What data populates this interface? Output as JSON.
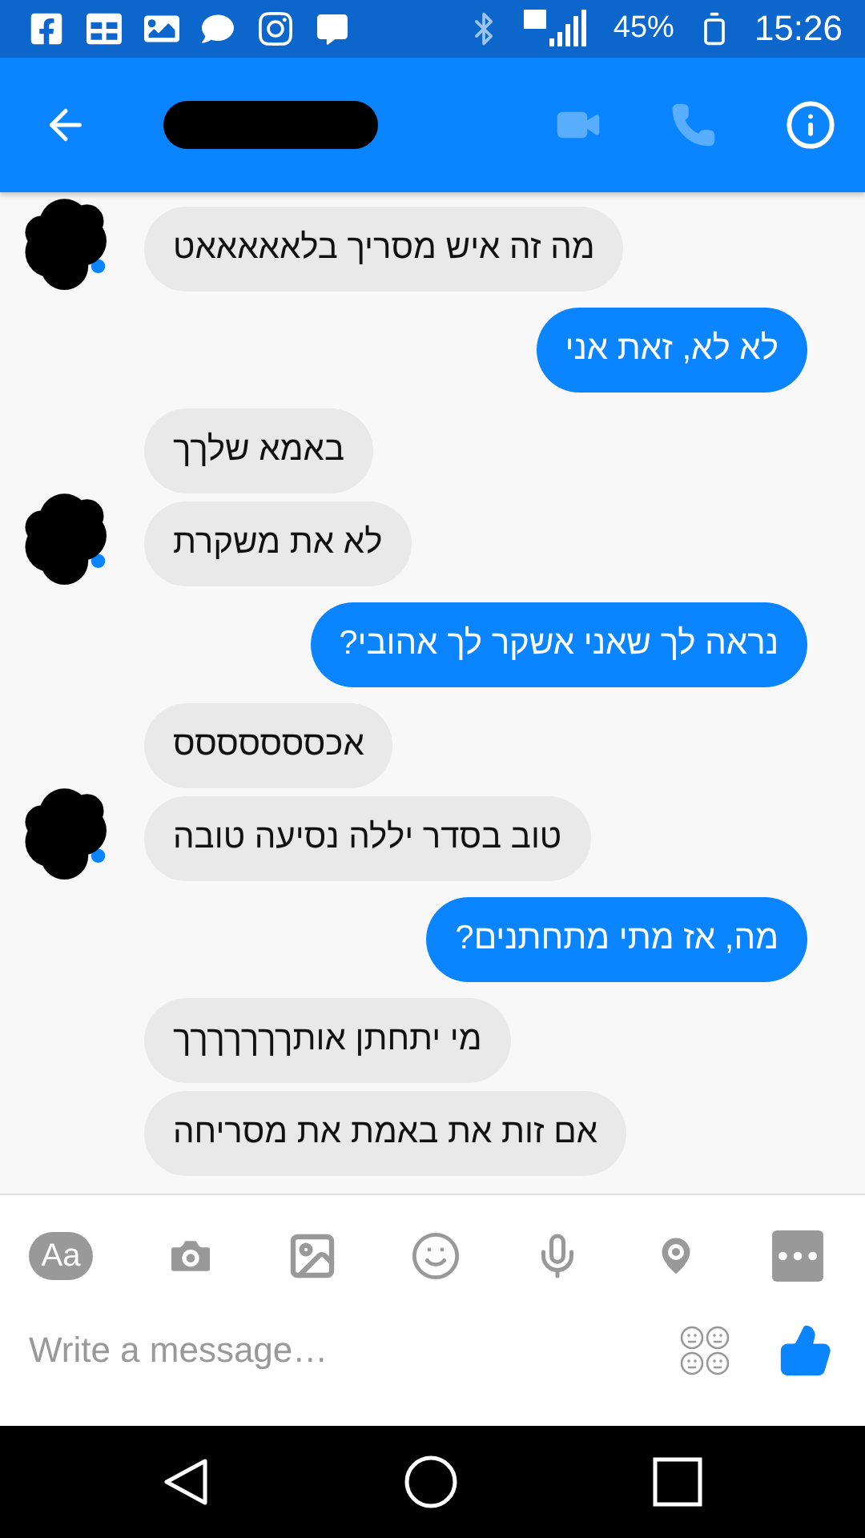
{
  "status_bar": {
    "battery": "45%",
    "time": "15:26"
  },
  "header": {
    "call_buttons": [
      {
        "kind": "video",
        "disabled": true
      },
      {
        "kind": "phone",
        "disabled": true
      }
    ]
  },
  "groups": [
    {
      "kind": "incoming",
      "messages": [
        {
          "kind": "text",
          "text": "מה זה איש מסריך בלאאאאאט"
        }
      ]
    },
    {
      "kind": "outgoing",
      "messages": [
        {
          "kind": "text",
          "text": "לא לא, זאת אני"
        }
      ]
    },
    {
      "kind": "incoming",
      "messages": [
        {
          "kind": "text",
          "text": "באמא שלךך"
        },
        {
          "kind": "text",
          "text": "לא את משקרת"
        }
      ]
    },
    {
      "kind": "outgoing",
      "messages": [
        {
          "kind": "text",
          "text": "נראה לך שאני אשקר לך אהובי?"
        }
      ]
    },
    {
      "kind": "incoming",
      "messages": [
        {
          "kind": "text",
          "text": "אכססססססס"
        },
        {
          "kind": "text",
          "text": "טוב בסדר יללה נסיעה טובה"
        }
      ]
    },
    {
      "kind": "outgoing",
      "messages": [
        {
          "kind": "text",
          "text": "מה, אז מתי מתחתנים?"
        }
      ]
    },
    {
      "kind": "incoming",
      "messages": [
        {
          "kind": "text",
          "text": "מי יתחתן אותךךךךךךך"
        },
        {
          "kind": "text",
          "text": "אם זות את באמת את מסריחה"
        }
      ]
    }
  ],
  "composer": {
    "text_button": "Aa",
    "placeholder": "Write a message…"
  }
}
